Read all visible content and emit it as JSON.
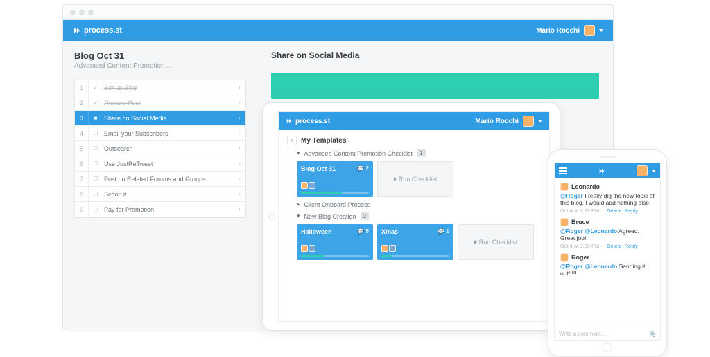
{
  "brand": "process.st",
  "user": "Mario Rocchi",
  "desktop": {
    "title": "Blog Oct 31",
    "subtitle": "Advanced Content Promotion...",
    "steps": [
      {
        "n": "1",
        "label": "Set-up Blog",
        "done": true
      },
      {
        "n": "2",
        "label": "Prepare Post",
        "done": true
      },
      {
        "n": "3",
        "label": "Share on Social Media",
        "active": true
      },
      {
        "n": "4",
        "label": "Email your Subscribers",
        "collapse": true
      },
      {
        "n": "5",
        "label": "Outsearch"
      },
      {
        "n": "6",
        "label": "Use JustReTweet"
      },
      {
        "n": "7",
        "label": "Post on Related Forums and Groups"
      },
      {
        "n": "8",
        "label": "Scoop.it"
      },
      {
        "n": "9",
        "label": "Pay for Promotion"
      }
    ],
    "main_heading": "Share on Social Media"
  },
  "tablet": {
    "crumb": "My Templates",
    "groups": [
      {
        "title": "Advanced Content Promotion Checklist",
        "count": "1",
        "open": true,
        "cards": [
          {
            "title": "Blog Oct 31",
            "comments": "2",
            "progress": 60
          }
        ],
        "run": "Run Checklist"
      },
      {
        "title": "Client Onboard Process",
        "open": false
      },
      {
        "title": "New Blog Creation",
        "count": "2",
        "open": true,
        "cards": [
          {
            "title": "Halloween",
            "comments": "5",
            "progress": 35
          },
          {
            "title": "Xmas",
            "comments": "1",
            "progress": 15
          }
        ],
        "run": "Run Checklist"
      }
    ]
  },
  "phone": {
    "comments": [
      {
        "author": "Leonardo",
        "mentions": [
          "@Roger"
        ],
        "text": " I really dig the new topic of this blog. I would add nothing else.",
        "time": "Oct 4 at 3:33 PM"
      },
      {
        "author": "Bruce",
        "mentions": [
          "@Roger",
          "@Leonardo"
        ],
        "text": " Agreed. Great job!!",
        "time": "Oct 4 at 3:33 PM"
      },
      {
        "author": "Roger",
        "mentions": [
          "@Roger",
          "@Leonardo"
        ],
        "text": " Sending it out!!!!!",
        "time": ""
      }
    ],
    "placeholder": "Write a comment...",
    "actions": {
      "delete": "Delete",
      "reply": "Reply"
    }
  }
}
